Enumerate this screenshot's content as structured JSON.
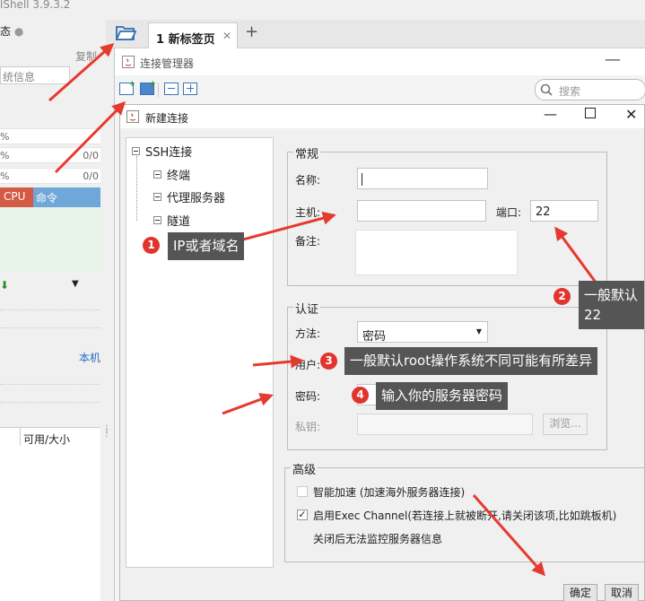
{
  "app": {
    "title": "lShell 3.9.3.2"
  },
  "sidebar": {
    "copy_label": "复制",
    "sys_info_placeholder": "统信息",
    "rows": [
      {
        "pct": "%",
        "value": ""
      },
      {
        "pct": "%",
        "value": "0/0"
      },
      {
        "pct": "%",
        "value": "0/0"
      }
    ],
    "cpu_label": "CPU",
    "cmd_label": "命令",
    "local_label": "本机",
    "avail_label": "可用/大小"
  },
  "tabs": [
    {
      "label": "1 新标签页"
    }
  ],
  "conn_manager": {
    "title": "连接管理器",
    "search_placeholder": "搜索"
  },
  "dialog": {
    "title": "新建连接",
    "tree": {
      "root": "SSH连接",
      "children": [
        "终端",
        "代理服务器",
        "隧道"
      ]
    },
    "general": {
      "legend": "常规",
      "name_label": "名称:",
      "name_value": "",
      "host_label": "主机:",
      "host_value": "",
      "port_label": "端口:",
      "port_value": "22",
      "note_label": "备注:",
      "note_value": ""
    },
    "auth": {
      "legend": "认证",
      "method_label": "方法:",
      "method_value": "密码",
      "user_label": "用户:",
      "password_label": "密码:",
      "key_label": "私钥:",
      "browse_label": "浏览..."
    },
    "advanced": {
      "legend": "高级",
      "smart_accel_label": "智能加速 (加速海外服务器连接)",
      "smart_accel_checked": false,
      "exec_channel_label": "启用Exec Channel(若连接上就被断开,请关闭该项,比如跳板机)",
      "exec_channel_checked": true,
      "exec_channel_note": "关闭后无法监控服务器信息"
    },
    "ok_label": "确定",
    "cancel_label": "取消"
  },
  "annotations": [
    {
      "num": "1",
      "text": "IP或者域名"
    },
    {
      "num": "2",
      "text": "一般默认22"
    },
    {
      "num": "3",
      "text": "一般默认root操作系统不同可能有所差异"
    },
    {
      "num": "4",
      "text": "输入你的服务器密码"
    }
  ],
  "colors": {
    "arrow": "#e53a2f",
    "callout_bg": "#555555",
    "cpu": "#d35a45",
    "cmd_bar": "#6fa7d8"
  }
}
